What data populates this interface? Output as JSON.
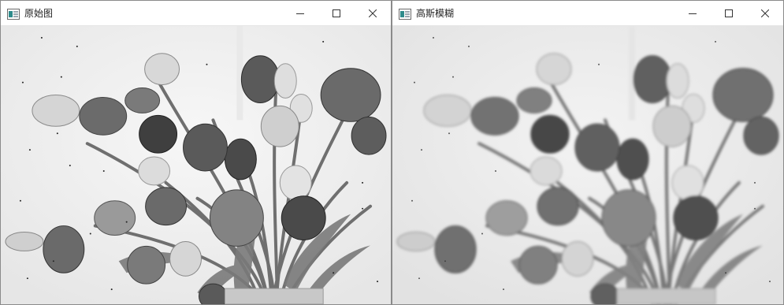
{
  "windows": [
    {
      "title": "原始图",
      "image_label": "tulips-grayscale-original"
    },
    {
      "title": "高斯模糊",
      "image_label": "tulips-grayscale-gaussian-blur"
    }
  ],
  "controls": {
    "minimize": "minimize",
    "maximize": "maximize",
    "close": "close"
  },
  "colors": {
    "title_bg": "#ffffff",
    "canvas_bg": "#f4f4f4",
    "icon_teal": "#2e8b8b",
    "icon_frame": "#6a6a6a"
  }
}
